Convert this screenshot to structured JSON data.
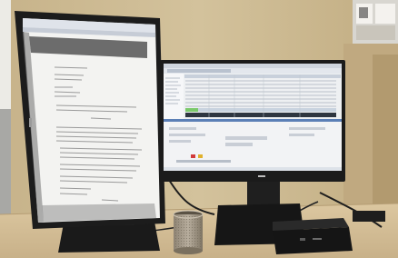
{
  "scene": {
    "description_role": "photo",
    "colors": {
      "wall": "#cdbb94",
      "wall_shadow": "#b9a37a",
      "desk": "#d8c29a",
      "desk_shadow": "#bfa77e",
      "monitor_black": "#1c1c1c",
      "monitor_frame": "#2a2a2a",
      "document_bg": "#f4f4f2",
      "document_dark_band": "#6d6d6d",
      "app_bg": "#eef0f2",
      "app_toolbar": "#d6dbe3",
      "app_highlight_green": "#7bc96b",
      "app_row_dark": "#2e3640",
      "cup_metal": "#a59a88",
      "laptop_dock": "#1a1a1a",
      "brand_logo": "#b8b8b8"
    },
    "objects": {
      "left_monitor": "portrait-monitor",
      "right_monitor": "landscape-monitor",
      "pen_cup": "pen-cup",
      "docking_station": "docking-station",
      "window_frame": "window-frame"
    }
  }
}
